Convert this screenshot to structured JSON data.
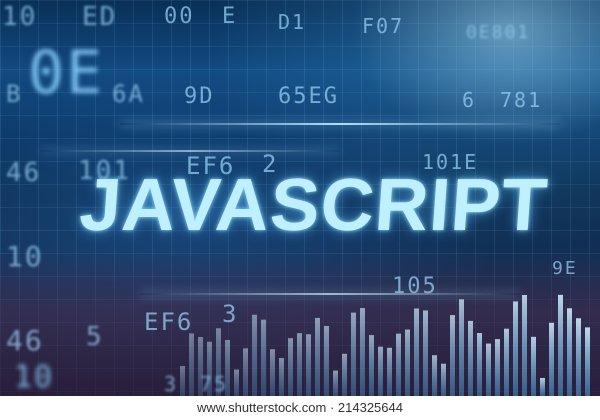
{
  "title": "JAVASCRIPT",
  "watermark": "www.shutterstock.com · 214325644",
  "colors": {
    "background": "#0b3561",
    "title": "#bff0ff",
    "band": "#5a2846"
  },
  "background_text": [
    "10",
    "ED",
    "00",
    "E",
    "D1",
    "F07",
    "0E801",
    "0E",
    "B",
    "6A",
    "9D",
    "65EG",
    "6",
    "781",
    "46",
    "101",
    "EF6",
    "2",
    "101E",
    "10",
    "9E",
    "105",
    "46",
    "5",
    "EF6",
    "3",
    "10",
    "3",
    "75"
  ]
}
